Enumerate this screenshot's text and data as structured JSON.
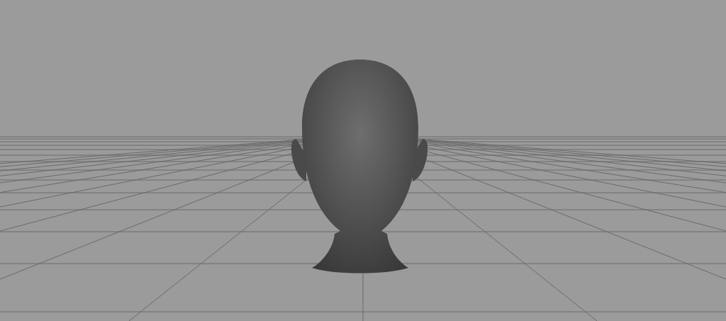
{
  "viewport": {
    "grid_visible": true,
    "model_visible": true
  }
}
